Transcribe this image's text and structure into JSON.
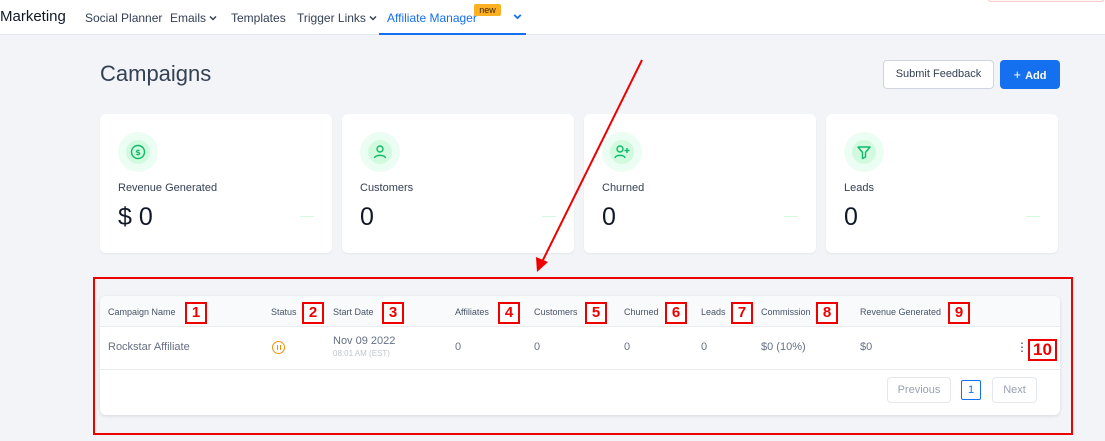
{
  "nav": {
    "brand": "Marketing",
    "items": [
      {
        "label": "Social Planner"
      },
      {
        "label": "Emails"
      },
      {
        "label": "Templates"
      },
      {
        "label": "Trigger Links"
      },
      {
        "label": "Affiliate Manager",
        "badge": "new"
      }
    ],
    "active_color": "#1570ef"
  },
  "header": {
    "title": "Campaigns",
    "feedback_button": "Submit Feedback",
    "add_button": "Add",
    "add_icon": "plus-icon"
  },
  "stats": [
    {
      "label": "Revenue Generated",
      "value": "$ 0",
      "icon": "dollar-circle-icon"
    },
    {
      "label": "Customers",
      "value": "0",
      "icon": "user-icon"
    },
    {
      "label": "Churned",
      "value": "0",
      "icon": "user-plus-icon"
    },
    {
      "label": "Leads",
      "value": "0",
      "icon": "funnel-icon"
    }
  ],
  "table": {
    "columns": [
      "Campaign Name",
      "Status",
      "Start Date",
      "Affiliates",
      "Customers",
      "Churned",
      "Leads",
      "Commission",
      "Revenue Generated"
    ],
    "rows": [
      {
        "name": "Rockstar Affiliate",
        "status_icon": "pause-icon",
        "start_date": "Nov 09 2022",
        "start_time": "08:01 AM (EST)",
        "affiliates": "0",
        "customers": "0",
        "churned": "0",
        "leads": "0",
        "commission": "$0 (10%)",
        "revenue": "$0",
        "menu_icon": "kebab-menu-icon"
      }
    ],
    "pagination": {
      "prev": "Previous",
      "page": "1",
      "next": "Next"
    }
  },
  "annotations": {
    "markers": [
      "1",
      "2",
      "3",
      "4",
      "5",
      "6",
      "7",
      "8",
      "9",
      "10"
    ],
    "color": "#ee0000"
  }
}
